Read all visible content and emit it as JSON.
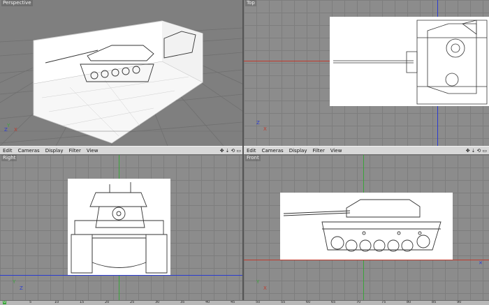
{
  "viewports": {
    "perspective": {
      "label": "Perspective"
    },
    "top": {
      "label": "Top"
    },
    "right": {
      "label": "Right"
    },
    "front": {
      "label": "Front"
    }
  },
  "menu": {
    "items": [
      "Edit",
      "Cameras",
      "Display",
      "Filter",
      "View"
    ]
  },
  "axes": {
    "x": "X",
    "y": "Y",
    "z": "Z"
  },
  "timeline": {
    "start_frame": "0",
    "ticks": [
      "5",
      "10",
      "15",
      "20",
      "25",
      "30",
      "35",
      "40",
      "45",
      "50",
      "55",
      "60",
      "65",
      "70",
      "75",
      "80",
      "85",
      "90"
    ]
  },
  "colors": {
    "viewport_bg": "#8c8c8c",
    "grid_line": "#7d7d7d",
    "axis_x": "#c0392b",
    "axis_y": "#3aa43a",
    "axis_z": "#2b3bd1",
    "menubar": "#d8d8d8"
  }
}
